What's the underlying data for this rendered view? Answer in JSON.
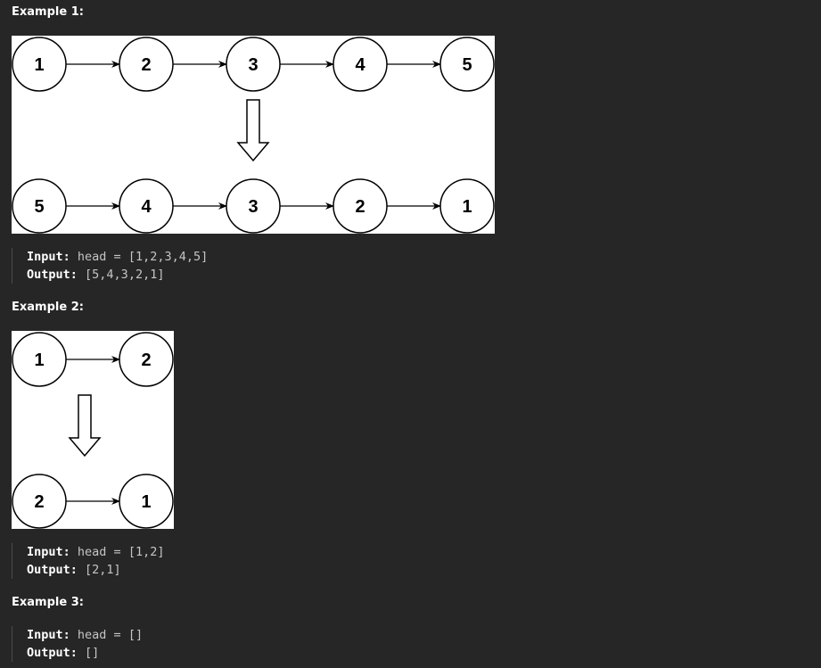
{
  "examples": [
    {
      "title": "Example 1:",
      "figure": {
        "before": [
          "1",
          "2",
          "3",
          "4",
          "5"
        ],
        "after": [
          "5",
          "4",
          "3",
          "2",
          "1"
        ]
      },
      "input_label": "Input:",
      "input_value": "head = [1,2,3,4,5]",
      "output_label": "Output:",
      "output_value": "[5,4,3,2,1]"
    },
    {
      "title": "Example 2:",
      "figure": {
        "before": [
          "1",
          "2"
        ],
        "after": [
          "2",
          "1"
        ]
      },
      "input_label": "Input:",
      "input_value": "head = [1,2]",
      "output_label": "Output:",
      "output_value": "[2,1]"
    },
    {
      "title": "Example 3:",
      "input_label": "Input:",
      "input_value": "head = []",
      "output_label": "Output:",
      "output_value": "[]"
    }
  ]
}
